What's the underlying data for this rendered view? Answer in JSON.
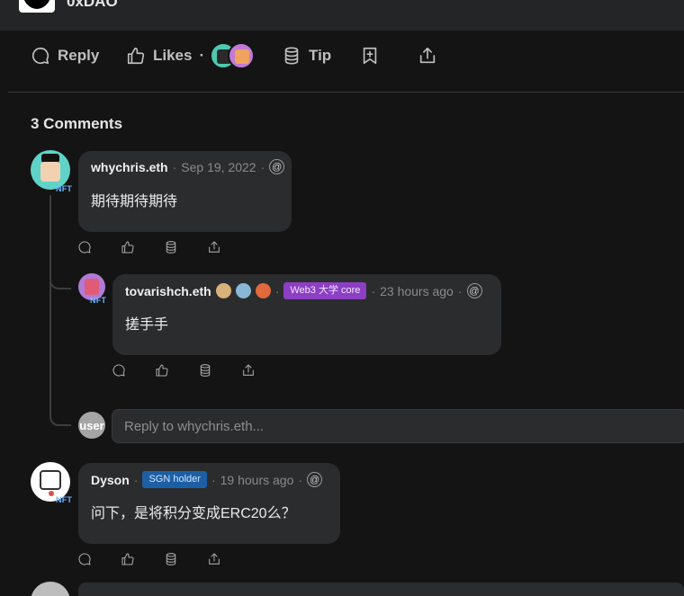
{
  "header": {
    "author_name": "0xDAO"
  },
  "post_actions": {
    "reply_label": "Reply",
    "likes_label": "Likes",
    "likes_sep": "·",
    "tip_label": "Tip"
  },
  "comments_title": "3 Comments",
  "nft_tag": "NFT",
  "comments": [
    {
      "author": "whychris.eth",
      "date": "Sep 19, 2022",
      "body": "期待期待期待"
    },
    {
      "author": "tovarishch.eth",
      "badge": "Web3 大学 core",
      "date": "23 hours ago",
      "body": "搓手手"
    },
    {
      "author": "Dyson",
      "badge": "SGN holder",
      "date": "19 hours ago",
      "body": "问下，是将积分变成ERC20么？"
    }
  ],
  "reply_box": {
    "placeholder": "Reply to whychris.eth...",
    "avatar_text": "user"
  },
  "sep": "·",
  "at_symbol": "@",
  "colors": {
    "background": "#141414",
    "bubble": "#2b2c2e",
    "badge_purple": "#8c3fc3",
    "badge_blue": "#1d5fa5",
    "nft_blue": "#6fb3ff"
  }
}
